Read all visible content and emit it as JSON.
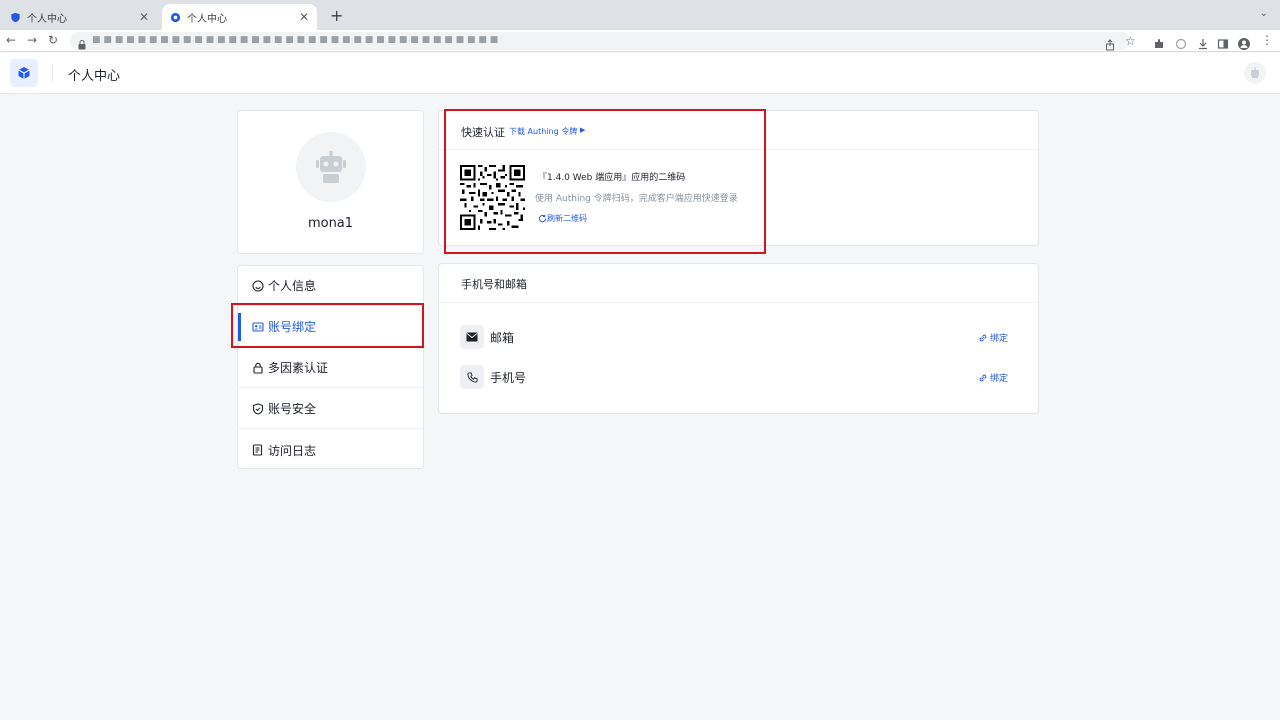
{
  "browser": {
    "tabs": [
      {
        "title": "个人中心",
        "active": false
      },
      {
        "title": "个人中心",
        "active": true
      }
    ],
    "new_tab": "+",
    "url": "■ ■ ■ ■ ■ ■ ■ ■ ■ ■ ■ ■ ■ ■ ■ ■ ■ ■ ■ ■ ■ ■ ■ ■ ■ ■ ■ ■ ■ ■ ■ ■ ■ ■ ■ ■"
  },
  "header": {
    "title": "个人中心"
  },
  "profile": {
    "username": "mona1"
  },
  "menu": {
    "items": [
      {
        "label": "个人信息",
        "icon": "smile-icon",
        "active": false
      },
      {
        "label": "账号绑定",
        "icon": "id-card-icon",
        "active": true
      },
      {
        "label": "多因素认证",
        "icon": "lock-icon",
        "active": false
      },
      {
        "label": "账号安全",
        "icon": "shield-icon",
        "active": false
      },
      {
        "label": "访问日志",
        "icon": "log-icon",
        "active": false
      }
    ]
  },
  "quick_auth": {
    "title": "快速认证",
    "download_link": "下载 Authing 令牌",
    "qr_title": "『1.4.0 Web 端应用』应用的二维码",
    "qr_desc": "使用 Authing 令牌扫码，完成客户端应用快速登录",
    "refresh": "刷新二维码"
  },
  "contacts": {
    "title": "手机号和邮箱",
    "rows": [
      {
        "label": "邮箱",
        "icon": "mail-icon",
        "action": "绑定"
      },
      {
        "label": "手机号",
        "icon": "phone-icon",
        "action": "绑定"
      }
    ]
  },
  "colors": {
    "accent": "#215ae5",
    "highlight": "#d4141c",
    "background": "#f5f6f8"
  }
}
